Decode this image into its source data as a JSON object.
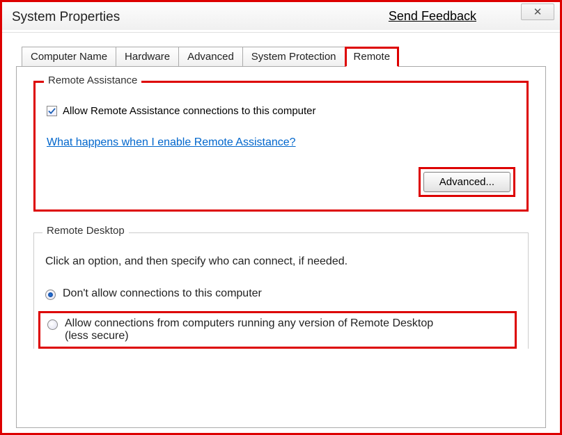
{
  "window": {
    "title": "System Properties",
    "feedback_link": "Send Feedback",
    "close_glyph": "✕"
  },
  "tabs": [
    {
      "label": "Computer Name",
      "active": false
    },
    {
      "label": "Hardware",
      "active": false
    },
    {
      "label": "Advanced",
      "active": false
    },
    {
      "label": "System Protection",
      "active": false
    },
    {
      "label": "Remote",
      "active": true,
      "highlighted": true
    }
  ],
  "remote_assistance": {
    "legend": "Remote Assistance",
    "allow_checkbox_label": "Allow Remote Assistance connections to this computer",
    "allow_checked": true,
    "help_link": "What happens when I enable Remote Assistance?",
    "advanced_button": "Advanced...",
    "highlighted": true
  },
  "remote_desktop": {
    "legend": "Remote Desktop",
    "instruction": "Click an option, and then specify who can connect, if needed.",
    "options": [
      {
        "label": "Don't allow connections to this computer",
        "checked": true,
        "highlighted": false
      },
      {
        "label": "Allow connections from computers running any version of Remote Desktop (less secure)",
        "checked": false,
        "highlighted": true
      }
    ]
  }
}
